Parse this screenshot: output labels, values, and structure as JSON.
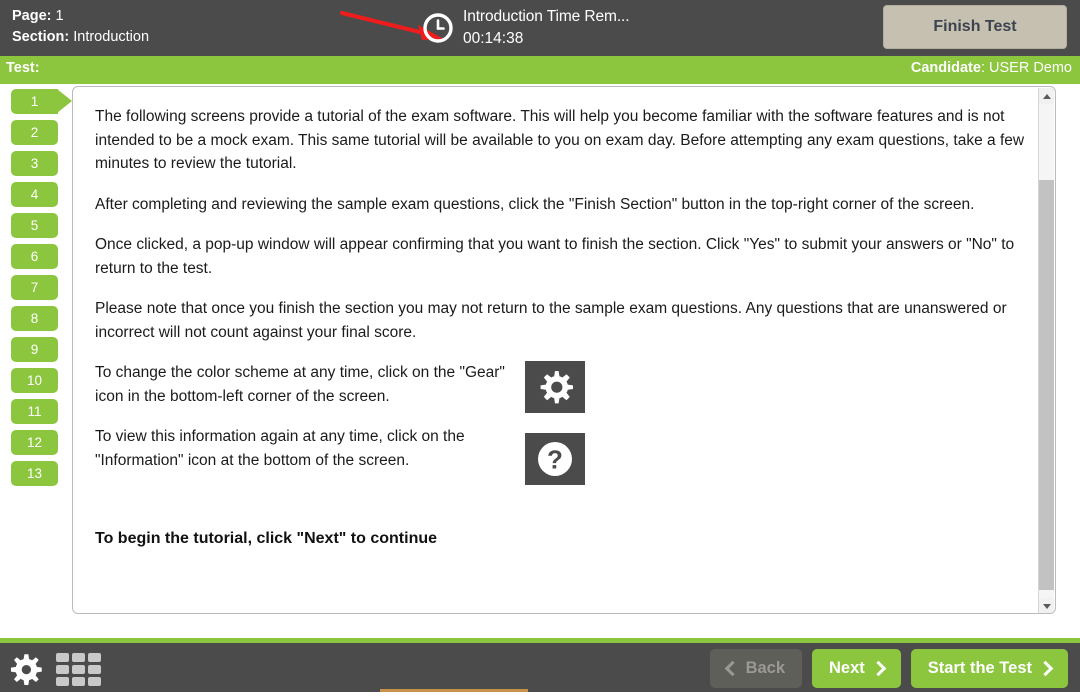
{
  "header": {
    "page_label": "Page:",
    "page_value": "1",
    "section_label": "Section:",
    "section_value": "Introduction",
    "timer_label": "Introduction Time Rem...",
    "timer_value": "00:14:38",
    "clock_icon": "clock-icon",
    "finish_test_label": "Finish Test",
    "annotation_arrow_icon": "red-arrow-annotation"
  },
  "test_bar": {
    "test_label": "Test:",
    "test_value": "",
    "candidate_label": "Candidate",
    "candidate_value": "USER Demo"
  },
  "sidebar": {
    "current_page": 1,
    "items": [
      {
        "label": "1"
      },
      {
        "label": "2"
      },
      {
        "label": "3"
      },
      {
        "label": "4"
      },
      {
        "label": "5"
      },
      {
        "label": "6"
      },
      {
        "label": "7"
      },
      {
        "label": "8"
      },
      {
        "label": "9"
      },
      {
        "label": "10"
      },
      {
        "label": "11"
      },
      {
        "label": "12"
      },
      {
        "label": "13"
      }
    ]
  },
  "content": {
    "paragraphs": [
      "The following screens provide a tutorial of the exam software. This will help you become familiar with the software features and is not intended to be a mock exam. This same tutorial will be available to you on exam day. Before attempting any exam questions, take a few minutes to review the tutorial.",
      "After completing and reviewing the sample exam questions, click the \"Finish Section\" button in the top-right corner of the screen.",
      "Once clicked, a pop-up window will appear confirming that you want to finish the section. Click \"Yes\" to submit your answers or \"No\" to return to the test.",
      "Please note that once you finish the section you may not return to the sample exam questions. Any questions that are unanswered or incorrect will not count against your final score."
    ],
    "gear_row_text": "To change the color scheme at any time, click on the \"Gear\" icon in the bottom-left corner of the screen.",
    "gear_icon": "gear-icon",
    "info_row_text": "To view this information again at any time, click on the \"Information\" icon at the bottom of the screen.",
    "info_icon": "question-mark-icon",
    "begin_note": "To begin the tutorial, click \"Next\" to continue"
  },
  "footer": {
    "settings_icon": "gear-icon",
    "grid_icon": "grid-icon",
    "back_label": "Back",
    "next_label": "Next",
    "start_label": "Start the Test"
  },
  "colors": {
    "green": "#8cc63e",
    "dark": "#4b4b4b",
    "beige": "#c6c0b0",
    "annotation_red": "#ee1c1c"
  }
}
